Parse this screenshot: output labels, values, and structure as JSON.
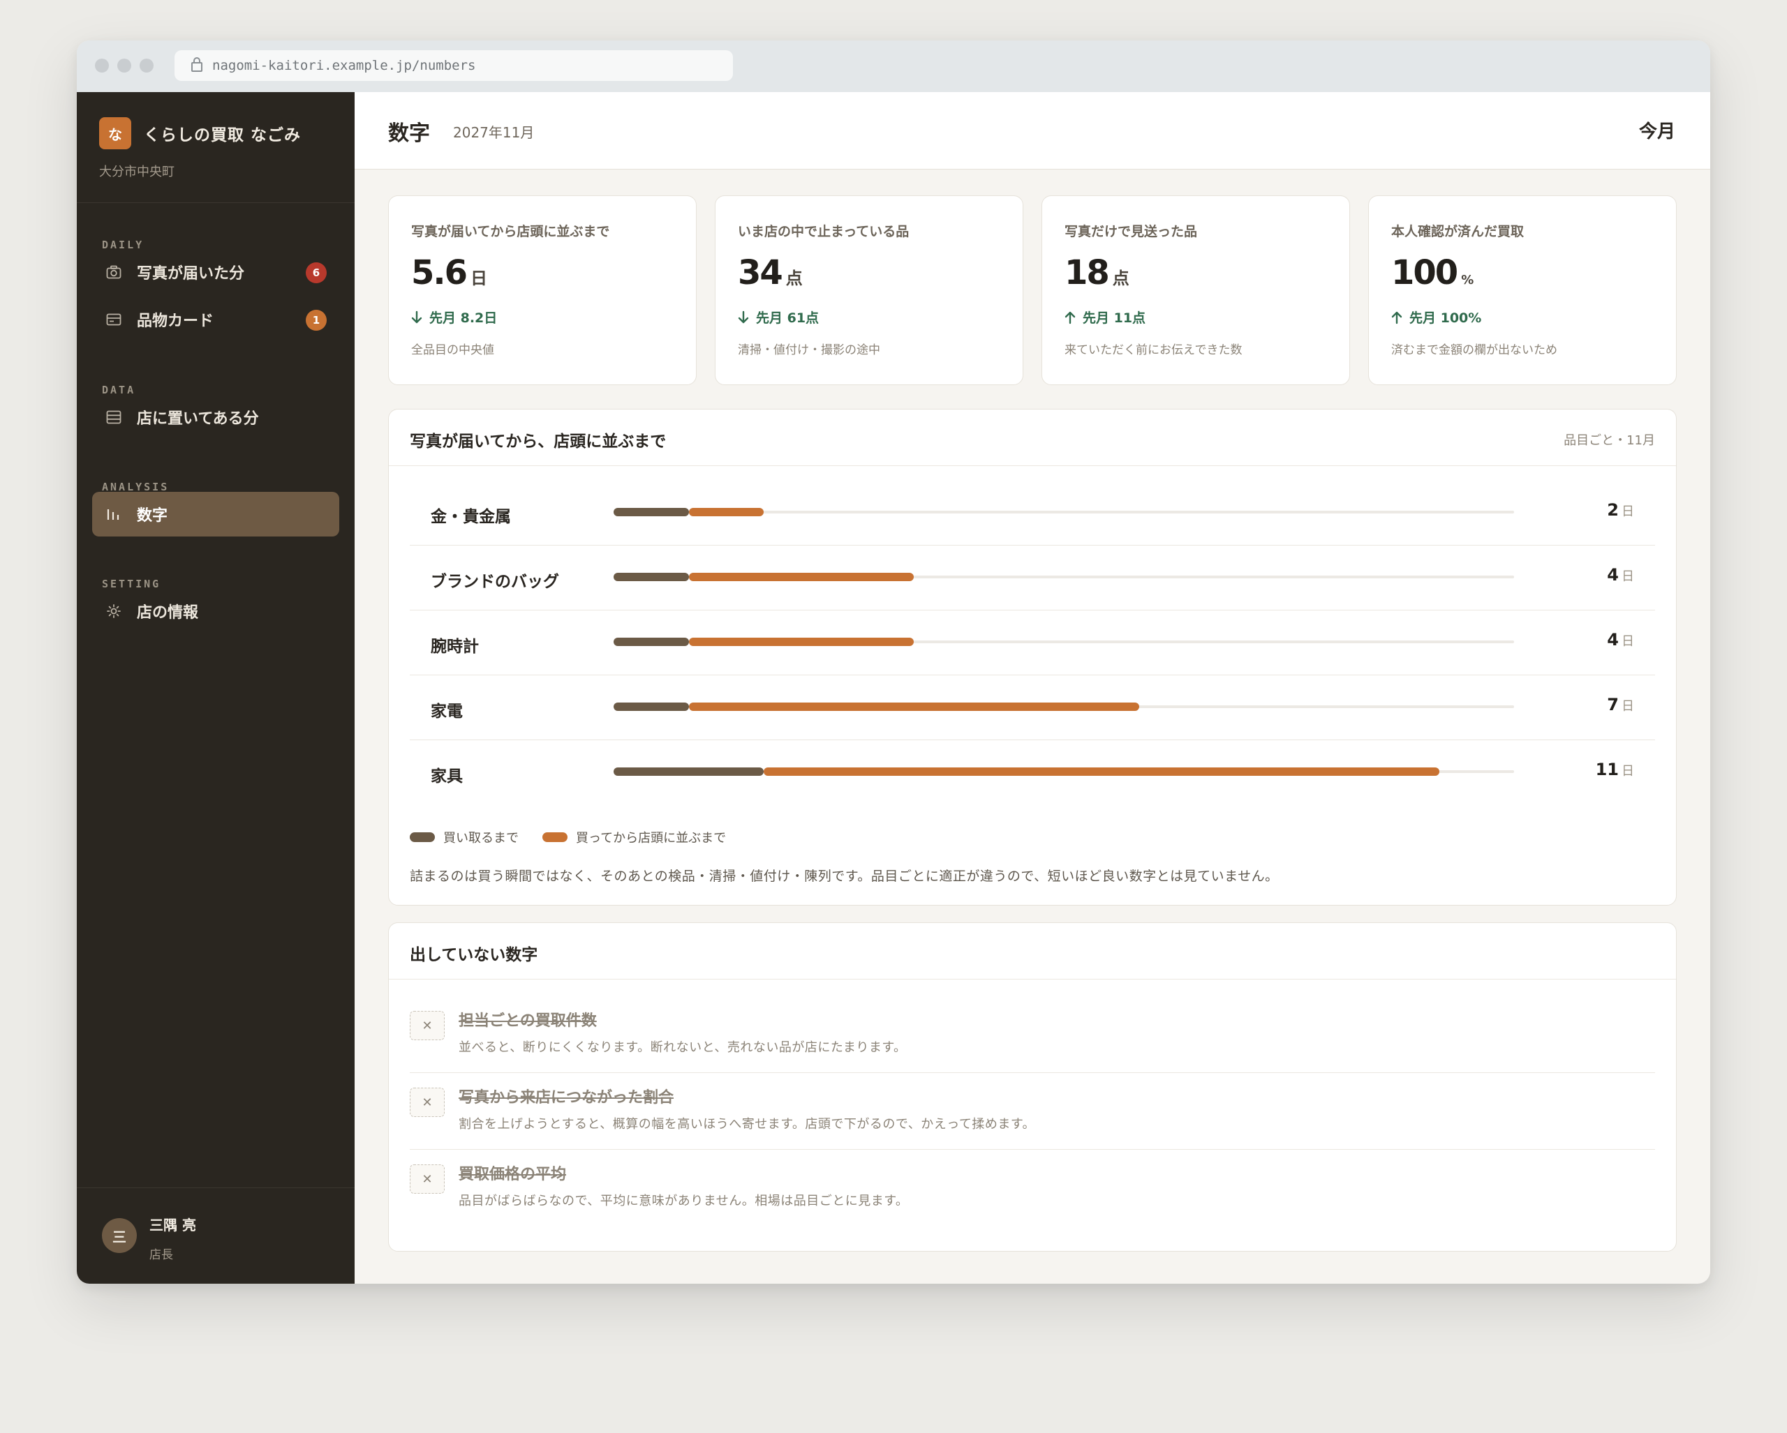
{
  "browser": {
    "url": "nagomi-kaitori.example.jp/numbers"
  },
  "brand": {
    "logo_char": "な",
    "name": "くらしの買取 なごみ",
    "location": "大分市中央町"
  },
  "sidebar": {
    "sections": [
      {
        "title": "DAILY"
      },
      {
        "title": "DATA"
      },
      {
        "title": "ANALYSIS"
      },
      {
        "title": "SETTING"
      }
    ],
    "items": [
      {
        "label": "写真が届いた分",
        "icon": "camera-icon",
        "badge": "6",
        "badge_color": "#b8392c"
      },
      {
        "label": "品物カード",
        "icon": "card-icon",
        "badge": "1",
        "badge_color": "#c87232"
      },
      {
        "label": "店に置いてある分",
        "icon": "list-icon"
      },
      {
        "label": "数字",
        "icon": "bar-chart-icon",
        "active": true
      },
      {
        "label": "店の情報",
        "icon": "gear-icon"
      }
    ]
  },
  "user": {
    "avatar_char": "三",
    "name": "三隅 亮",
    "role": "店長"
  },
  "header": {
    "title": "数字",
    "subtitle": "2027年11月",
    "period": "今月"
  },
  "kpis": [
    {
      "label": "写真が届いてから店頭に並ぶまで",
      "value": "5.6",
      "unit": "日",
      "direction": "down",
      "delta": "先月 8.2日",
      "note": "全品目の中央値"
    },
    {
      "label": "いま店の中で止まっている品",
      "value": "34",
      "unit": "点",
      "direction": "down",
      "delta": "先月 61点",
      "note": "清掃・値付け・撮影の途中"
    },
    {
      "label": "写真だけで見送った品",
      "value": "18",
      "unit": "点",
      "direction": "up",
      "delta": "先月 11点",
      "note": "来ていただく前にお伝えできた数"
    },
    {
      "label": "本人確認が済んだ買取",
      "value": "100",
      "unit": "%",
      "direction": "up",
      "delta": "先月 100%",
      "note": "済むまで金額の欄が出ないため"
    }
  ],
  "lead_time": {
    "title": "写真が届いてから、店頭に並ぶまで",
    "meta": "品目ごと・11月",
    "unit": "日",
    "scale_max": 12,
    "rows": [
      {
        "label": "金・貴金属",
        "buy": 1,
        "shelf": 1,
        "total": "2"
      },
      {
        "label": "ブランドのバッグ",
        "buy": 1,
        "shelf": 3,
        "total": "4"
      },
      {
        "label": "腕時計",
        "buy": 1,
        "shelf": 3,
        "total": "4"
      },
      {
        "label": "家電",
        "buy": 1,
        "shelf": 6,
        "total": "7"
      },
      {
        "label": "家具",
        "buy": 2,
        "shelf": 9,
        "total": "11"
      }
    ],
    "legend": [
      {
        "label": "買い取るまで",
        "color": "#6b5a46"
      },
      {
        "label": "買ってから店頭に並ぶまで",
        "color": "#c87232"
      }
    ],
    "note": "詰まるのは買う瞬間ではなく、そのあとの検品・清掃・値付け・陳列です。品目ごとに適正が違うので、短いほど良い数字とは見ていません。"
  },
  "hidden_metrics": {
    "title": "出していない数字",
    "items": [
      {
        "title": "担当ごとの買取件数",
        "desc": "並べると、断りにくくなります。断れないと、売れない品が店にたまります。"
      },
      {
        "title": "写真から来店につながった割合",
        "desc": "割合を上げようとすると、概算の幅を高いほうへ寄せます。店頭で下がるので、かえって揉めます。"
      },
      {
        "title": "買取価格の平均",
        "desc": "品目がばらばらなので、平均に意味がありません。相場は品目ごとに見ます。"
      }
    ]
  }
}
